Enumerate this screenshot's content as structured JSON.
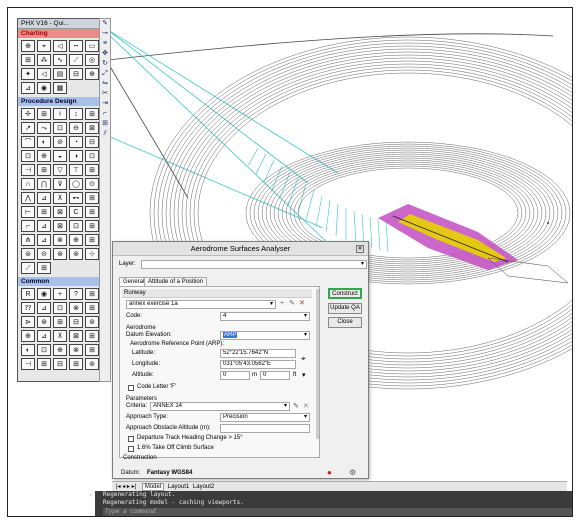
{
  "palette": {
    "title": "PHX V16 - Qui...",
    "sections": [
      "Charting",
      "Procedure Design",
      "Common"
    ],
    "common_letters": [
      "R",
      "C"
    ]
  },
  "dialog": {
    "title": "Aerodrome Surfaces Analyser",
    "layer_label": "Layer:",
    "tabs": [
      "General",
      "Attitude of a Position"
    ],
    "runway_header": "Runway",
    "runway_value": "annex exercise 1a",
    "code_label": "Code:",
    "code_value": "4",
    "aerodrome_label": "Aerodrome",
    "datum_elev_label": "Datum Elevation:",
    "datum_elev_value": "ARP",
    "arp_label": "Aerodrome Reference Point (ARP):",
    "latitude_label": "Latitude:",
    "latitude_value": "52°22'15.7642\"N",
    "longitude_label": "Longitude:",
    "longitude_value": "031°05'43.0582\"E",
    "altitude_label": "Altitude:",
    "altitude_value": "0",
    "altitude_sep": "m",
    "altitude_value2": "0",
    "altitude_unit": "ft",
    "code_letter_f": "Code Letter 'F'",
    "parameters_label": "Parameters",
    "criteria_label": "Criteria:",
    "criteria_value": "ANNEX 14",
    "approach_type_label": "Approach Type:",
    "approach_type_value": "Precision",
    "approach_obstacle_label": "Approach Obstacle Altitude (m):",
    "departure_track_label": "Departure Track Heading Change > 15°",
    "takeoff_climb_label": "1.6% Take Off Climb Surface",
    "construction_label": "Construction",
    "datum_label": "Datum:",
    "datum_value": "Fantasy WGS84",
    "buttons": {
      "construct": "Construct",
      "update_qa": "Update QA",
      "close": "Close"
    }
  },
  "layout_tabs": [
    "Model",
    "Layout1",
    "Layout2"
  ],
  "command_line": {
    "lines": [
      "Regenerating layout.",
      "Regenerating model - caching viewports."
    ],
    "placeholder": "Type a command"
  }
}
